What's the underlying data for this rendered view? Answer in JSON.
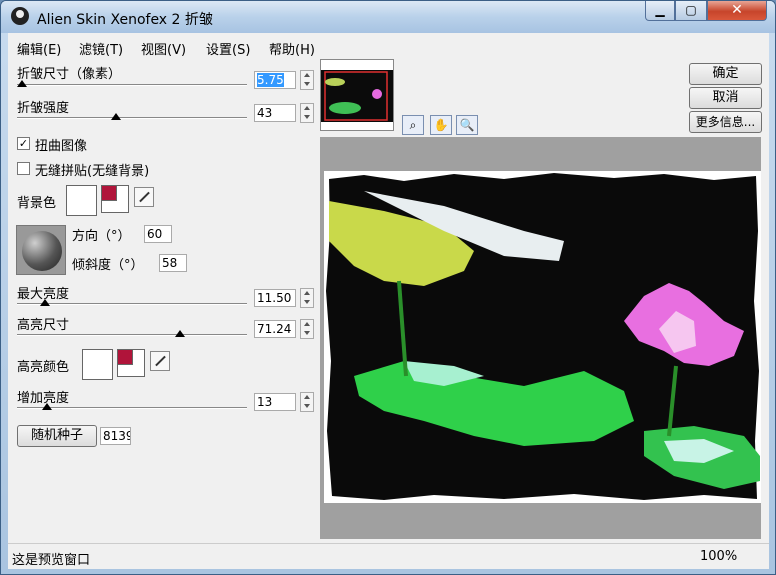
{
  "window": {
    "title": "Alien Skin Xenofex 2 折皱",
    "minimize": "▁",
    "maximize": "▢",
    "close": "✕"
  },
  "menu": [
    "编辑(E)",
    "滤镜(T)",
    "视图(V)",
    "设置(S)",
    "帮助(H)"
  ],
  "controls": {
    "crease_size": {
      "label": "折皱尺寸（像素）",
      "value": "5.75",
      "level": 0.02
    },
    "crease_strength": {
      "label": "折皱强度",
      "value": "43",
      "level": 0.43
    },
    "distort_image": {
      "label": "扭曲图像",
      "checked": true
    },
    "seamless_tile": {
      "label": "无缝拼贴(无缝背景)",
      "checked": false
    },
    "background_color": {
      "label": "背景色",
      "color": "#ffffff",
      "swatch_color": "#b0143a"
    },
    "direction": {
      "label": "方向（°）",
      "value": "60"
    },
    "tilt": {
      "label": "倾斜度（°）",
      "value": "58"
    },
    "max_brightness": {
      "label": "最大亮度",
      "value": "11.50",
      "level": 0.12
    },
    "highlight_size": {
      "label": "高亮尺寸",
      "value": "71.24",
      "level": 0.71
    },
    "highlight_color": {
      "label": "高亮颜色",
      "color": "#ffffff",
      "swatch_color": "#b0143a"
    },
    "add_brightness": {
      "label": "增加亮度",
      "value": "13",
      "level": 0.13
    },
    "random_seed": {
      "label": "随机种子",
      "value": "8139"
    }
  },
  "buttons": {
    "ok": "确定",
    "cancel": "取消",
    "more_info": "更多信息..."
  },
  "status": {
    "text": "这是预览窗口",
    "zoom": "100%"
  },
  "colors": {
    "accent": "#3399ff",
    "swatch_red": "#b0143a"
  }
}
